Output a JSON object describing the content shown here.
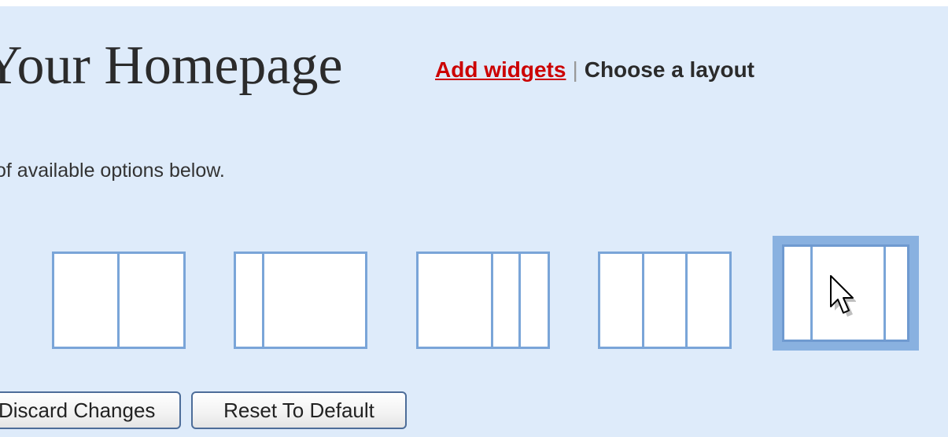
{
  "header": {
    "title": "Your Homepage",
    "nav": {
      "add_widgets": "Add widgets",
      "separator": "|",
      "choose_layout": "Choose a layout"
    }
  },
  "instructions": "of available options below.",
  "layouts": [
    {
      "name": "two-equal-columns",
      "selected": false
    },
    {
      "name": "narrow-left-wide-right",
      "selected": false
    },
    {
      "name": "wide-left-two-narrow-right",
      "selected": false
    },
    {
      "name": "three-equal-columns",
      "selected": false
    },
    {
      "name": "narrow-wide-narrow",
      "selected": true
    }
  ],
  "buttons": {
    "discard": "Discard Changes",
    "reset": "Reset To Default"
  },
  "colors": {
    "background": "#deebfa",
    "link": "#cc0000",
    "layout_border": "#7aa5d8",
    "selected_highlight": "#89b1e0"
  },
  "icons": {
    "cursor": "mouse-pointer-icon"
  }
}
